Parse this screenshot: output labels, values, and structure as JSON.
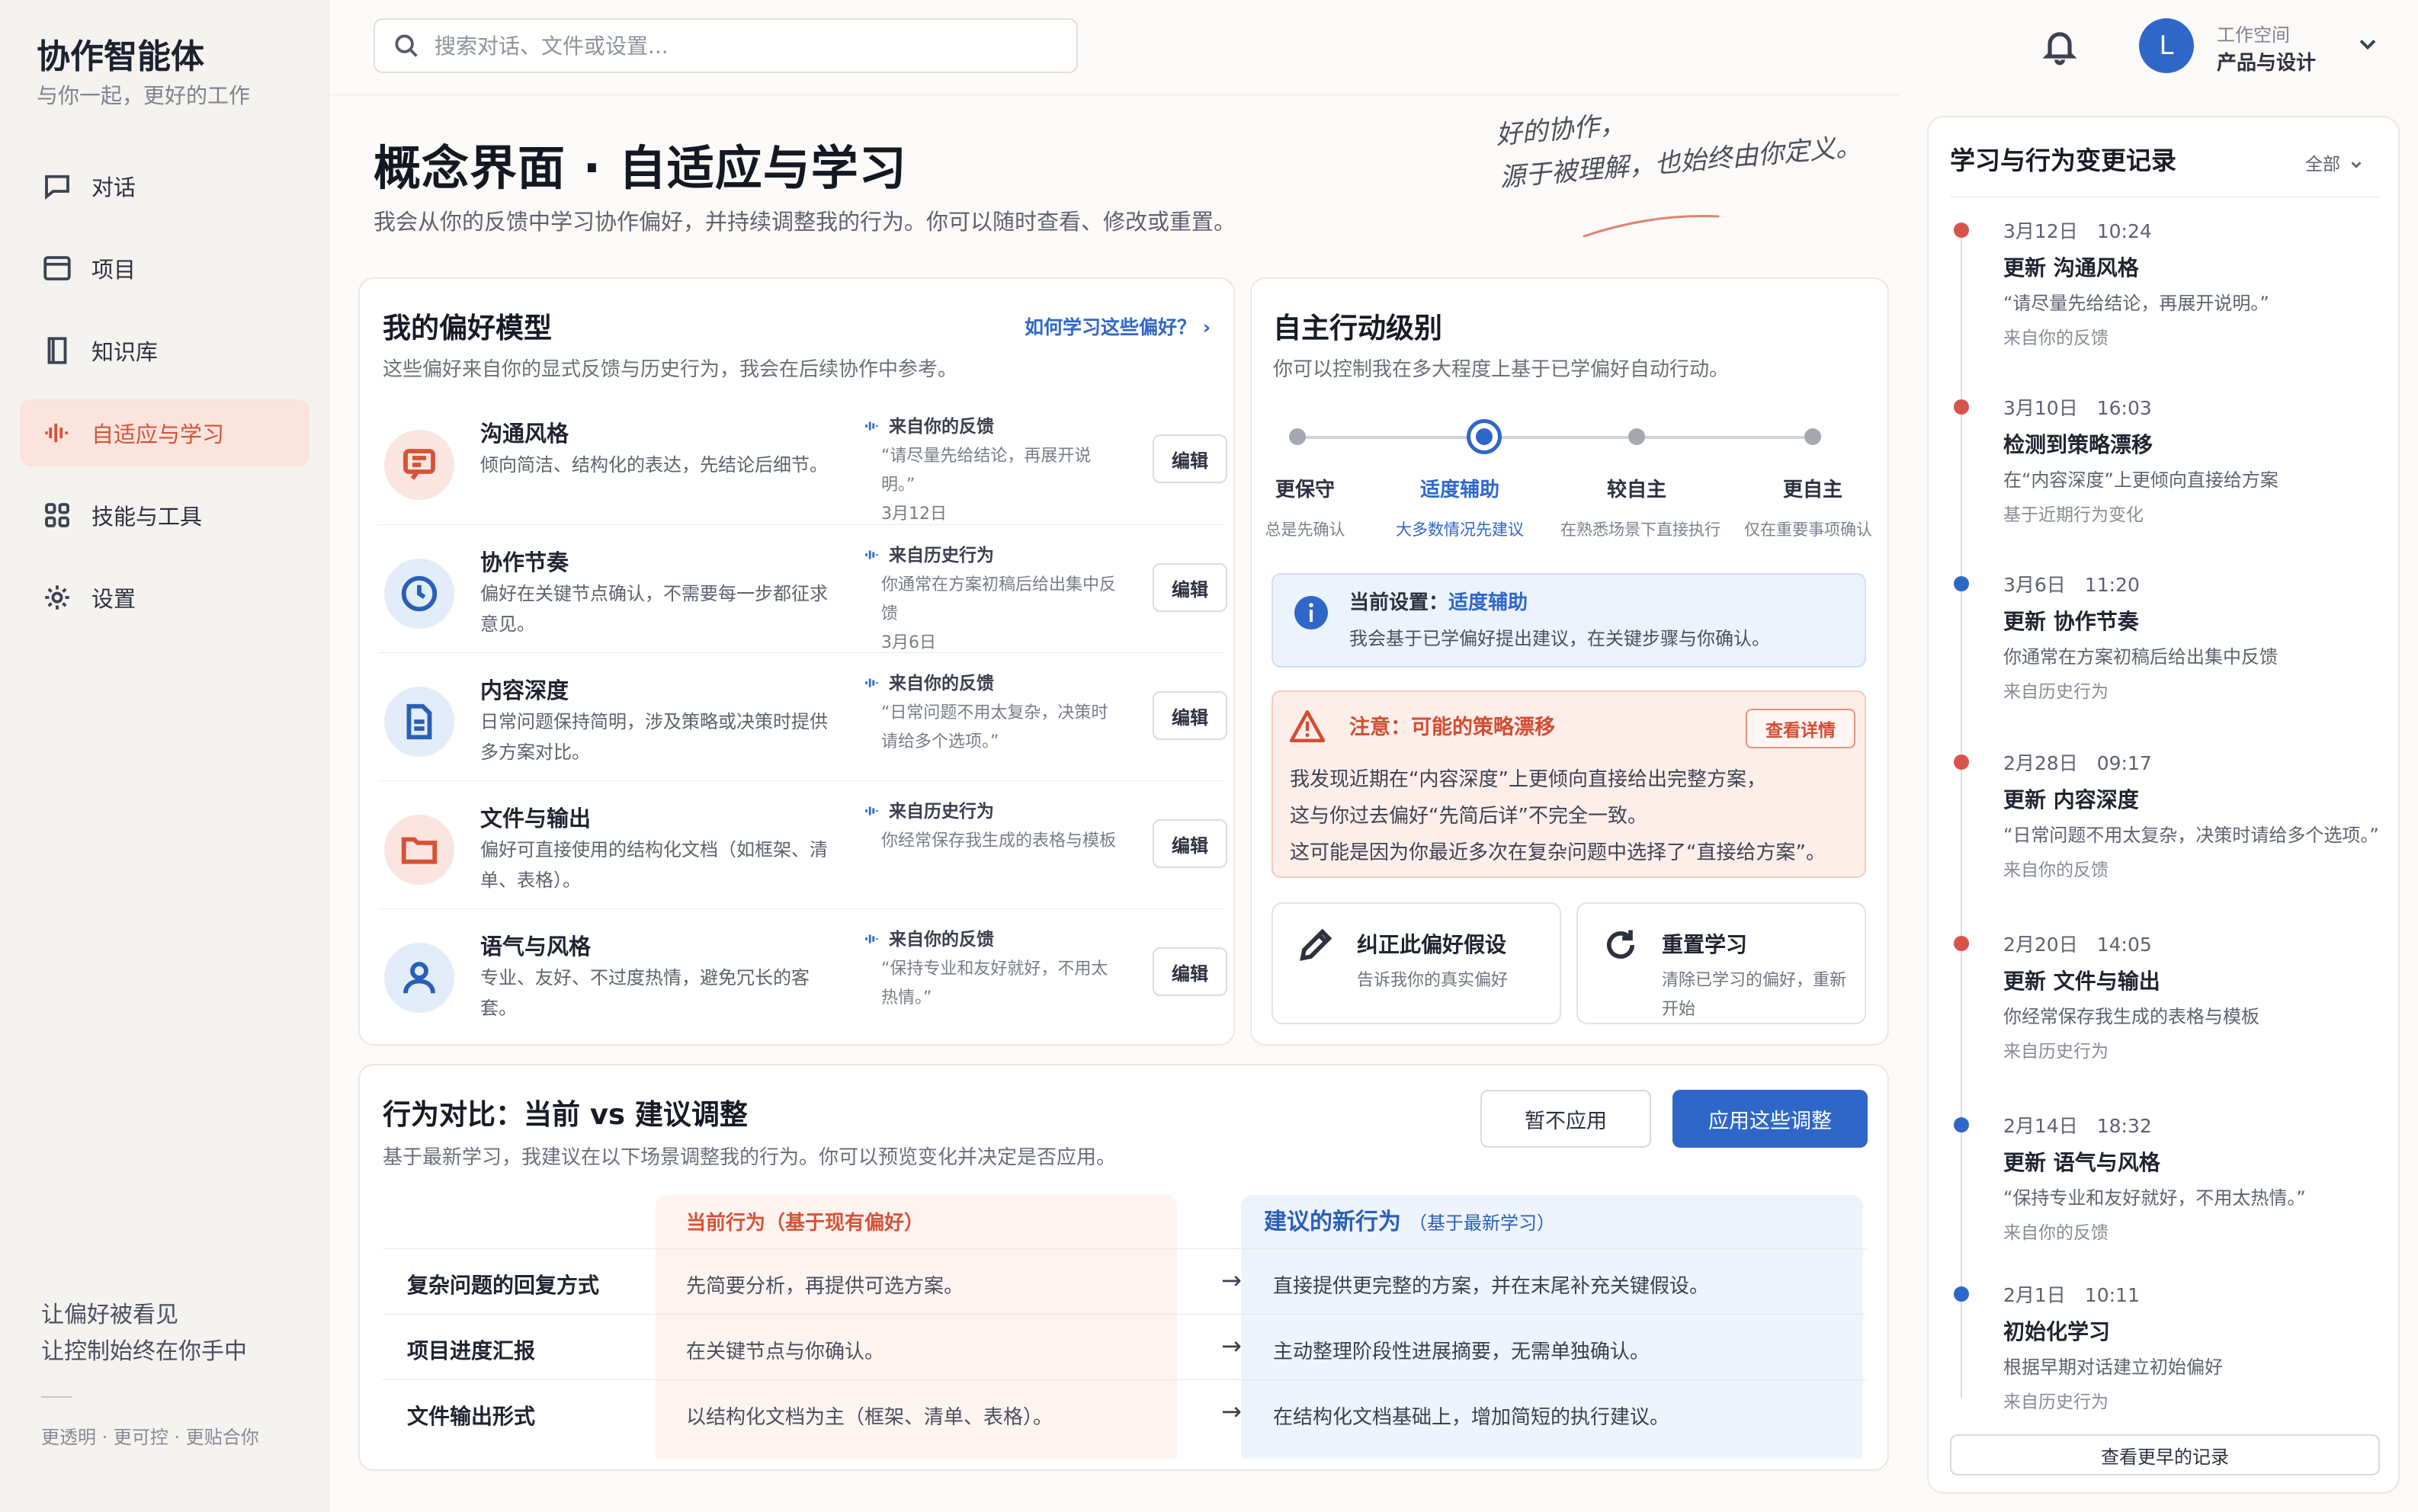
{
  "brand": {
    "title": "协作智能体",
    "subtitle": "与你一起，更好的工作"
  },
  "nav": [
    {
      "label": "对话",
      "icon": "chat-icon"
    },
    {
      "label": "项目",
      "icon": "folder-icon"
    },
    {
      "label": "知识库",
      "icon": "book-icon"
    },
    {
      "label": "自适应与学习",
      "icon": "waveform-icon",
      "active": true
    },
    {
      "label": "技能与工具",
      "icon": "grid-icon"
    },
    {
      "label": "设置",
      "icon": "gear-icon"
    }
  ],
  "sidebar_footer": {
    "line1": "让偏好被看见",
    "line2": "让控制始终在你手中",
    "tags": "更透明 · 更可控 · 更贴合你"
  },
  "search": {
    "placeholder": "搜索对话、文件或设置..."
  },
  "user": {
    "avatar_letter": "L",
    "workspace_label": "工作空间",
    "workspace_name": "产品与设计"
  },
  "header": {
    "title": "概念界面 · 自适应与学习",
    "description": "我会从你的反馈中学习协作偏好，并持续调整我的行为。你可以随时查看、修改或重置。",
    "quote_line1": "好的协作，",
    "quote_line2": "源于被理解，也始终由你定义。"
  },
  "preferences": {
    "title": "我的偏好模型",
    "description": "这些偏好来自你的显式反馈与历史行为，我会在后续协作中参考。",
    "link": "如何学习这些偏好？ ›",
    "edit_label": "编辑",
    "items": [
      {
        "name": "沟通风格",
        "text": "倾向简洁、结构化的表达，先结论后细节。",
        "source": "来自你的反馈",
        "quote": "“请尽量先给结论，再展开说明。”",
        "date": "3月12日"
      },
      {
        "name": "协作节奏",
        "text": "偏好在关键节点确认，不需要每一步都征求意见。",
        "source": "来自历史行为",
        "quote": "你通常在方案初稿后给出集中反馈",
        "date": "3月6日"
      },
      {
        "name": "内容深度",
        "text": "日常问题保持简明，涉及策略或决策时提供多方案对比。",
        "source": "来自你的反馈",
        "quote": "“日常问题不用太复杂，决策时请给多个选项。”",
        "date": ""
      },
      {
        "name": "文件与输出",
        "text": "偏好可直接使用的结构化文档（如框架、清单、表格）。",
        "source": "来自历史行为",
        "quote": "你经常保存我生成的表格与模板",
        "date": ""
      },
      {
        "name": "语气与风格",
        "text": "专业、友好、不过度热情，避免冗长的客套。",
        "source": "来自你的反馈",
        "quote": "“保持专业和友好就好，不用太热情。”",
        "date": ""
      }
    ]
  },
  "autonomy": {
    "title": "自主行动级别",
    "description": "你可以控制我在多大程度上基于已学偏好自动行动。",
    "current_level": 1,
    "levels": [
      {
        "name": "更保守",
        "desc": "总是先确认"
      },
      {
        "name": "适度辅助",
        "desc": "大多数情况先建议"
      },
      {
        "name": "较自主",
        "desc": "在熟悉场景下直接执行"
      },
      {
        "name": "更自主",
        "desc": "仅在重要事项确认"
      }
    ],
    "info_prefix": "当前设置：",
    "info_value": "适度辅助",
    "info_desc": "我会基于已学偏好提出建议，在关键步骤与你确认。",
    "warning_title": "注意：可能的策略漂移",
    "warning_button": "查看详情",
    "warning_lines": [
      "我发现近期在“内容深度”上更倾向直接给出完整方案，",
      "这与你过去偏好“先简后详”不完全一致。",
      "这可能是因为你最近多次在复杂问题中选择了“直接给方案”。"
    ],
    "action_correct_title": "纠正此偏好假设",
    "action_correct_desc": "告诉我你的真实偏好",
    "action_reset_title": "重置学习",
    "action_reset_desc": "清除已学习的偏好，重新开始"
  },
  "compare": {
    "title": "行为对比：当前 vs 建议调整",
    "description": "基于最新学习，我建议在以下场景调整我的行为。你可以预览变化并决定是否应用。",
    "btn_skip": "暂不应用",
    "btn_apply": "应用这些调整",
    "current_header": "当前行为（基于现有偏好）",
    "new_header": "建议的新行为",
    "new_header_note": "（基于最新学习）",
    "arrow": "→",
    "rows": [
      {
        "scenario": "复杂问题的回复方式",
        "current": "先简要分析，再提供可选方案。",
        "suggested": "直接提供更完整的方案，并在末尾补充关键假设。"
      },
      {
        "scenario": "项目进度汇报",
        "current": "在关键节点与你确认。",
        "suggested": "主动整理阶段性进展摘要，无需单独确认。"
      },
      {
        "scenario": "文件输出形式",
        "current": "以结构化文档为主（框架、清单、表格）。",
        "suggested": "在结构化文档基础上，增加简短的执行建议。"
      }
    ]
  },
  "log": {
    "title": "学习与行为变更记录",
    "filter": "全部",
    "more_button": "查看更早的记录",
    "events": [
      {
        "time": "3月12日　10:24",
        "title": "更新 沟通风格",
        "detail": "“请尽量先给结论，再展开说明。”",
        "source": "来自你的反馈",
        "color": "#d9534a"
      },
      {
        "time": "3月10日　16:03",
        "title": "检测到策略漂移",
        "detail": "在“内容深度”上更倾向直接给方案",
        "source": "基于近期行为变化",
        "color": "#d9534a"
      },
      {
        "time": "3月6日　11:20",
        "title": "更新 协作节奏",
        "detail": "你通常在方案初稿后给出集中反馈",
        "source": "来自历史行为",
        "color": "#2f67c9"
      },
      {
        "time": "2月28日　09:17",
        "title": "更新 内容深度",
        "detail": "“日常问题不用太复杂，决策时请给多个选项。”",
        "source": "来自你的反馈",
        "color": "#d9534a"
      },
      {
        "time": "2月20日　14:05",
        "title": "更新 文件与输出",
        "detail": "你经常保存我生成的表格与模板",
        "source": "来自历史行为",
        "color": "#d9534a"
      },
      {
        "time": "2月14日　18:32",
        "title": "更新 语气与风格",
        "detail": "“保持专业和友好就好，不用太热情。”",
        "source": "来自你的反馈",
        "color": "#2f67c9"
      },
      {
        "time": "2月1日　10:11",
        "title": "初始化学习",
        "detail": "根据早期对话建立初始偏好",
        "source": "来自历史行为",
        "color": "#2f67c9"
      }
    ]
  }
}
